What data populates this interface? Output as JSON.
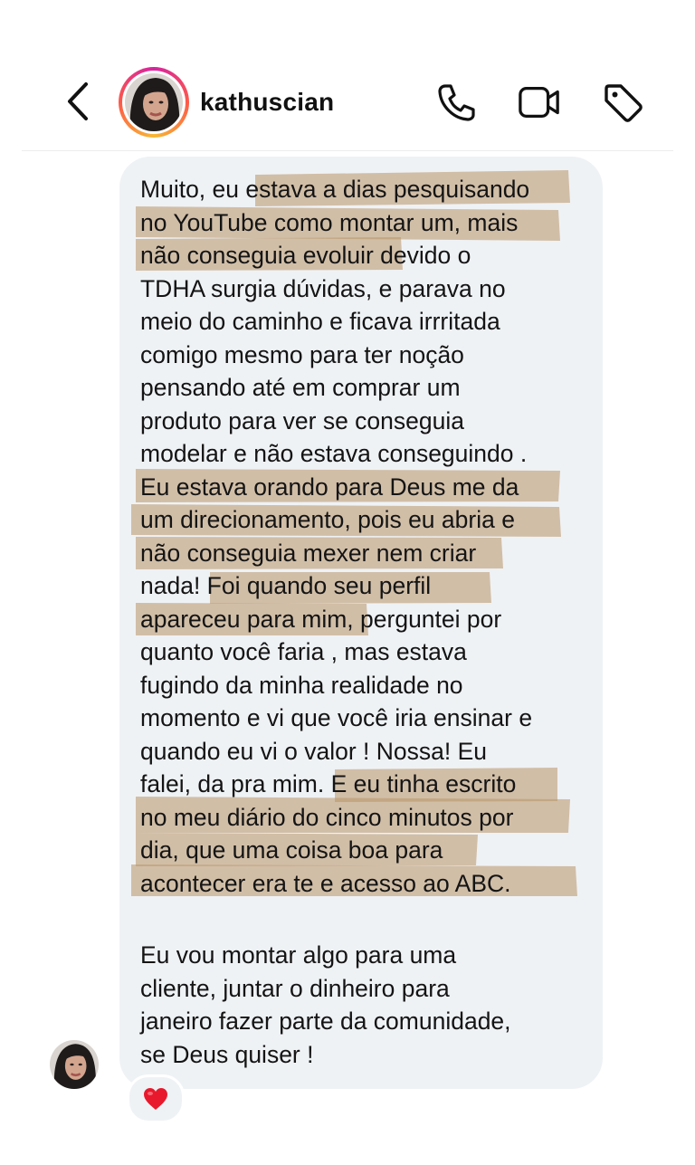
{
  "header": {
    "username": "kathuscian",
    "back_icon": "chevron-left-icon",
    "call_icon": "phone-icon",
    "video_icon": "video-camera-icon",
    "tag_icon": "tag-icon"
  },
  "conversation": {
    "messages": [
      {
        "text": "Muito, eu estava a dias pesquisando\nno YouTube como montar um, mais\nnão conseguia evoluir devido o\nTDHA surgia dúvidas, e parava no\nmeio do caminho e ficava irrritada\ncomigo mesmo para ter noção\npensando até em comprar um\nproduto para ver se conseguia\nmodelar e não estava conseguindo .\nEu estava orando para Deus me da\num direcionamento, pois eu abria e\nnão conseguia mexer nem criar\nnada! Foi quando seu perfil\napareceu para mim, perguntei por\nquanto você faria , mas estava\nfugindo da minha realidade no\nmomento e vi que você iria ensinar e\nquando eu vi o valor ! Nossa! Eu\nfalei, da pra mim. E eu tinha escrito\nno meu diário do cinco minutos por\ndia, que uma coisa boa para\nacontecer era te e acesso ao ABC."
      },
      {
        "text": "Eu vou montar algo para uma\ncliente, juntar o dinheiro para\njaneiro fazer parte da comunidade,\nse Deus quiser !"
      }
    ],
    "reaction": "❤️",
    "highlight_color": "#b89466"
  }
}
